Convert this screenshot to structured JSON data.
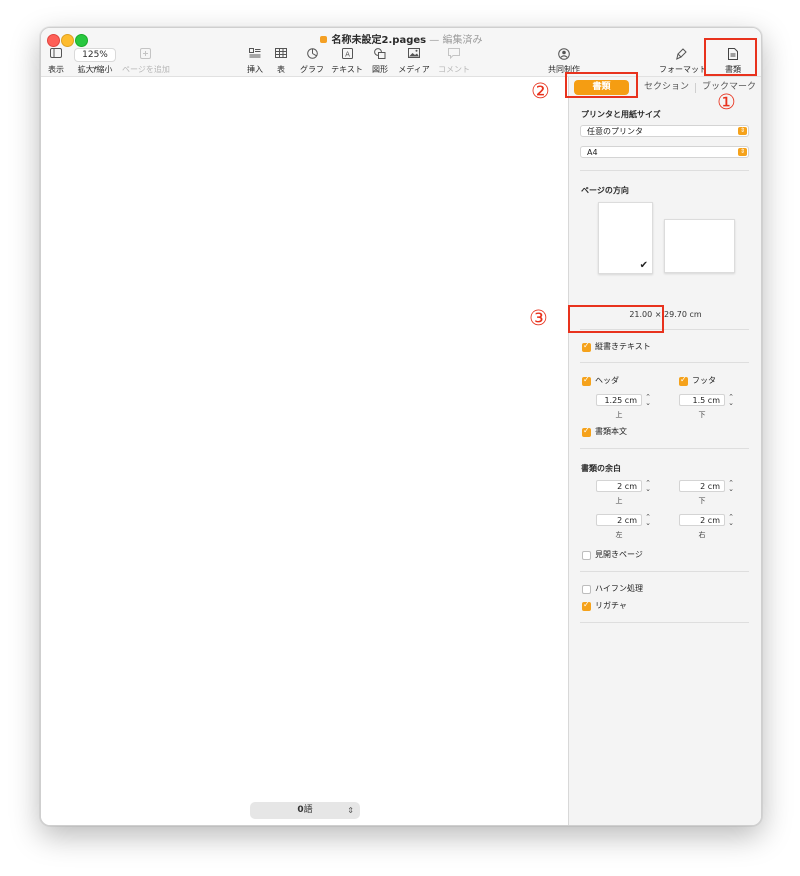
{
  "window": {
    "file_name": "名称未設定2.pages",
    "separator": "—",
    "state": "編集済み"
  },
  "toolbar": {
    "view": "表示",
    "zoom_value": "125%",
    "zoom_label": "拡大/縮小",
    "add_page": "ページを追加",
    "insert": "挿入",
    "table": "表",
    "chart": "グラフ",
    "text": "テキスト",
    "shape": "図形",
    "media": "メディア",
    "comment": "コメント",
    "collaborate": "共同制作",
    "format": "フォーマット",
    "document": "書類"
  },
  "status": {
    "word_count": "0",
    "word_unit": "語"
  },
  "sidebar": {
    "tabs": [
      "書類",
      "セクション",
      "ブックマーク"
    ],
    "printer_section_title": "プリンタと用紙サイズ",
    "printer_value": "任意のプリンタ",
    "paper_value": "A4",
    "orientation_title": "ページの方向",
    "paper_dims": "21.00 × 29.70 cm",
    "vertical_text_label": "縦書きテキスト",
    "vertical_text_checked": true,
    "header_label": "ヘッダ",
    "header_checked": true,
    "footer_label": "フッタ",
    "footer_checked": true,
    "header_value": "1.25 cm",
    "header_sub": "上",
    "footer_value": "1.5 cm",
    "footer_sub": "下",
    "body_label": "書類本文",
    "body_checked": true,
    "margins_title": "書類の余白",
    "margin_top": "2 cm",
    "margin_top_label": "上",
    "margin_bottom": "2 cm",
    "margin_bottom_label": "下",
    "margin_left": "2 cm",
    "margin_left_label": "左",
    "margin_right": "2 cm",
    "margin_right_label": "右",
    "facing_pages_label": "見開きページ",
    "facing_pages_checked": false,
    "hyphenation_label": "ハイフン処理",
    "hyphenation_checked": false,
    "ligatures_label": "リガチャ",
    "ligatures_checked": true
  },
  "annotations": [
    "①",
    "②",
    "③"
  ],
  "colors": {
    "accent": "#f59d12",
    "annotation_red": "#e8321d"
  }
}
